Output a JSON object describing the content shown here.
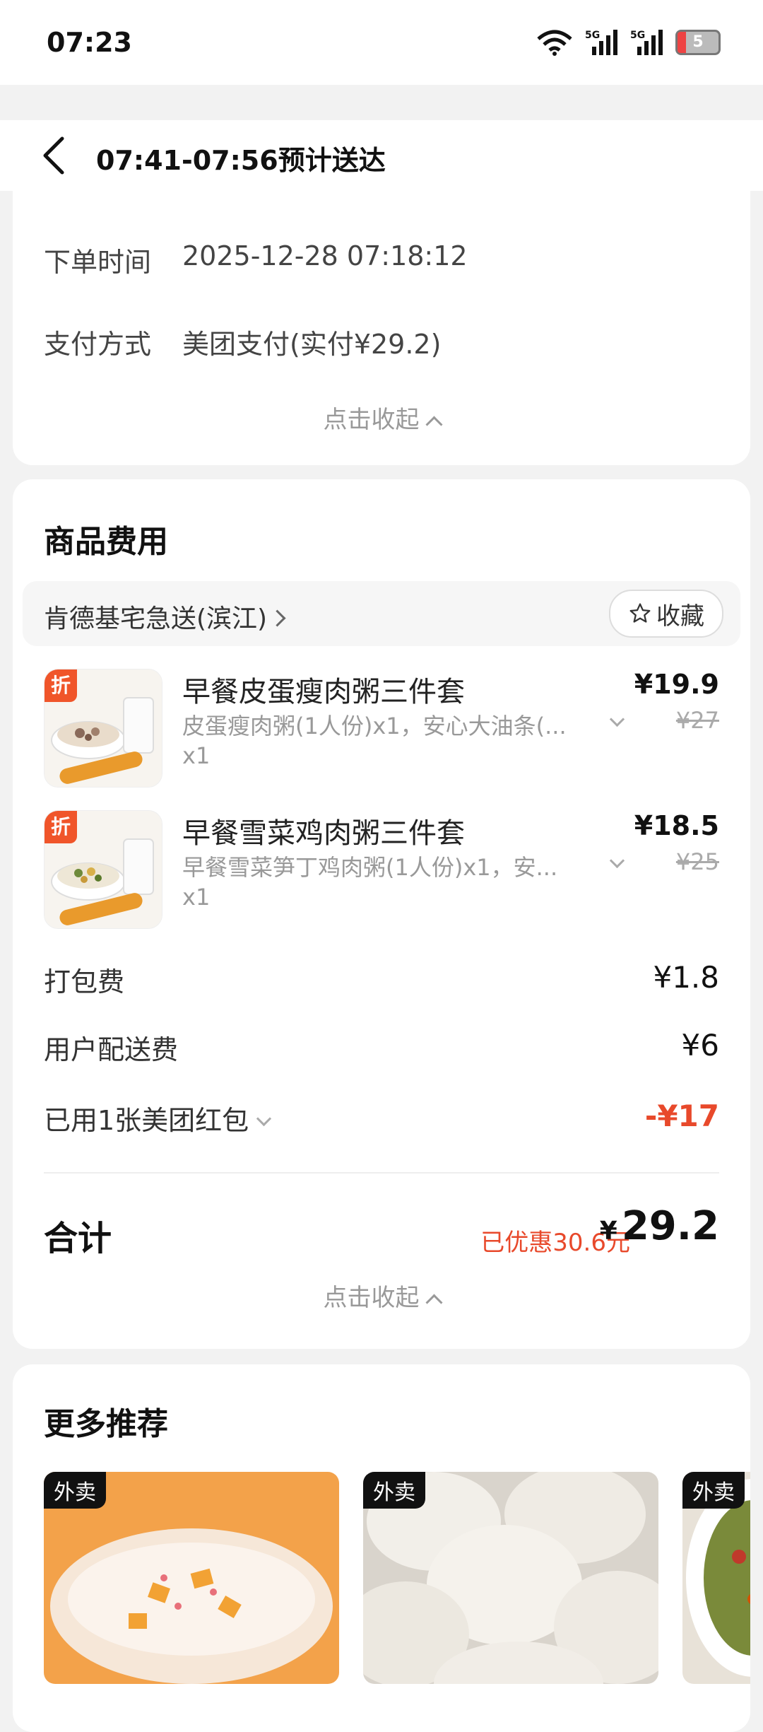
{
  "status_bar": {
    "time": "07:23",
    "battery": "5",
    "net1": "5G",
    "net2": "5G"
  },
  "nav": {
    "title": "07:41-07:56预计送达"
  },
  "order_info": {
    "rows": [
      {
        "label": "下单时间",
        "value": "2025-12-28 07:18:12"
      },
      {
        "label": "支付方式",
        "value": "美团支付(实付¥29.2)"
      }
    ],
    "collapse_label": "点击收起"
  },
  "costs": {
    "title": "商品费用",
    "shop_name": "肯德基宅急送(滨江)",
    "favorite_label": "收藏",
    "items": [
      {
        "badge": "折",
        "name": "早餐皮蛋瘦肉粥三件套",
        "desc": "皮蛋瘦肉粥(1人份)x1，安心大油条(...",
        "qty": "x1",
        "price": "¥19.9",
        "original_price": "¥27"
      },
      {
        "badge": "折",
        "name": "早餐雪菜鸡肉粥三件套",
        "desc": "早餐雪菜笋丁鸡肉粥(1人份)x1，安...",
        "qty": "x1",
        "price": "¥18.5",
        "original_price": "¥25"
      }
    ],
    "fees": [
      {
        "label": "打包费",
        "value": "¥1.8"
      },
      {
        "label": "用户配送费",
        "value": "¥6"
      },
      {
        "label": "已用1张美团红包",
        "value": "-¥17"
      }
    ],
    "total_label": "合计",
    "saved": "已优惠30.6元",
    "total_currency": "¥",
    "total_value": "29.2",
    "collapse_label": "点击收起"
  },
  "recommend": {
    "title": "更多推荐",
    "cards": [
      {
        "tag": "外卖"
      },
      {
        "tag": "外卖"
      },
      {
        "tag": "外卖"
      }
    ]
  }
}
